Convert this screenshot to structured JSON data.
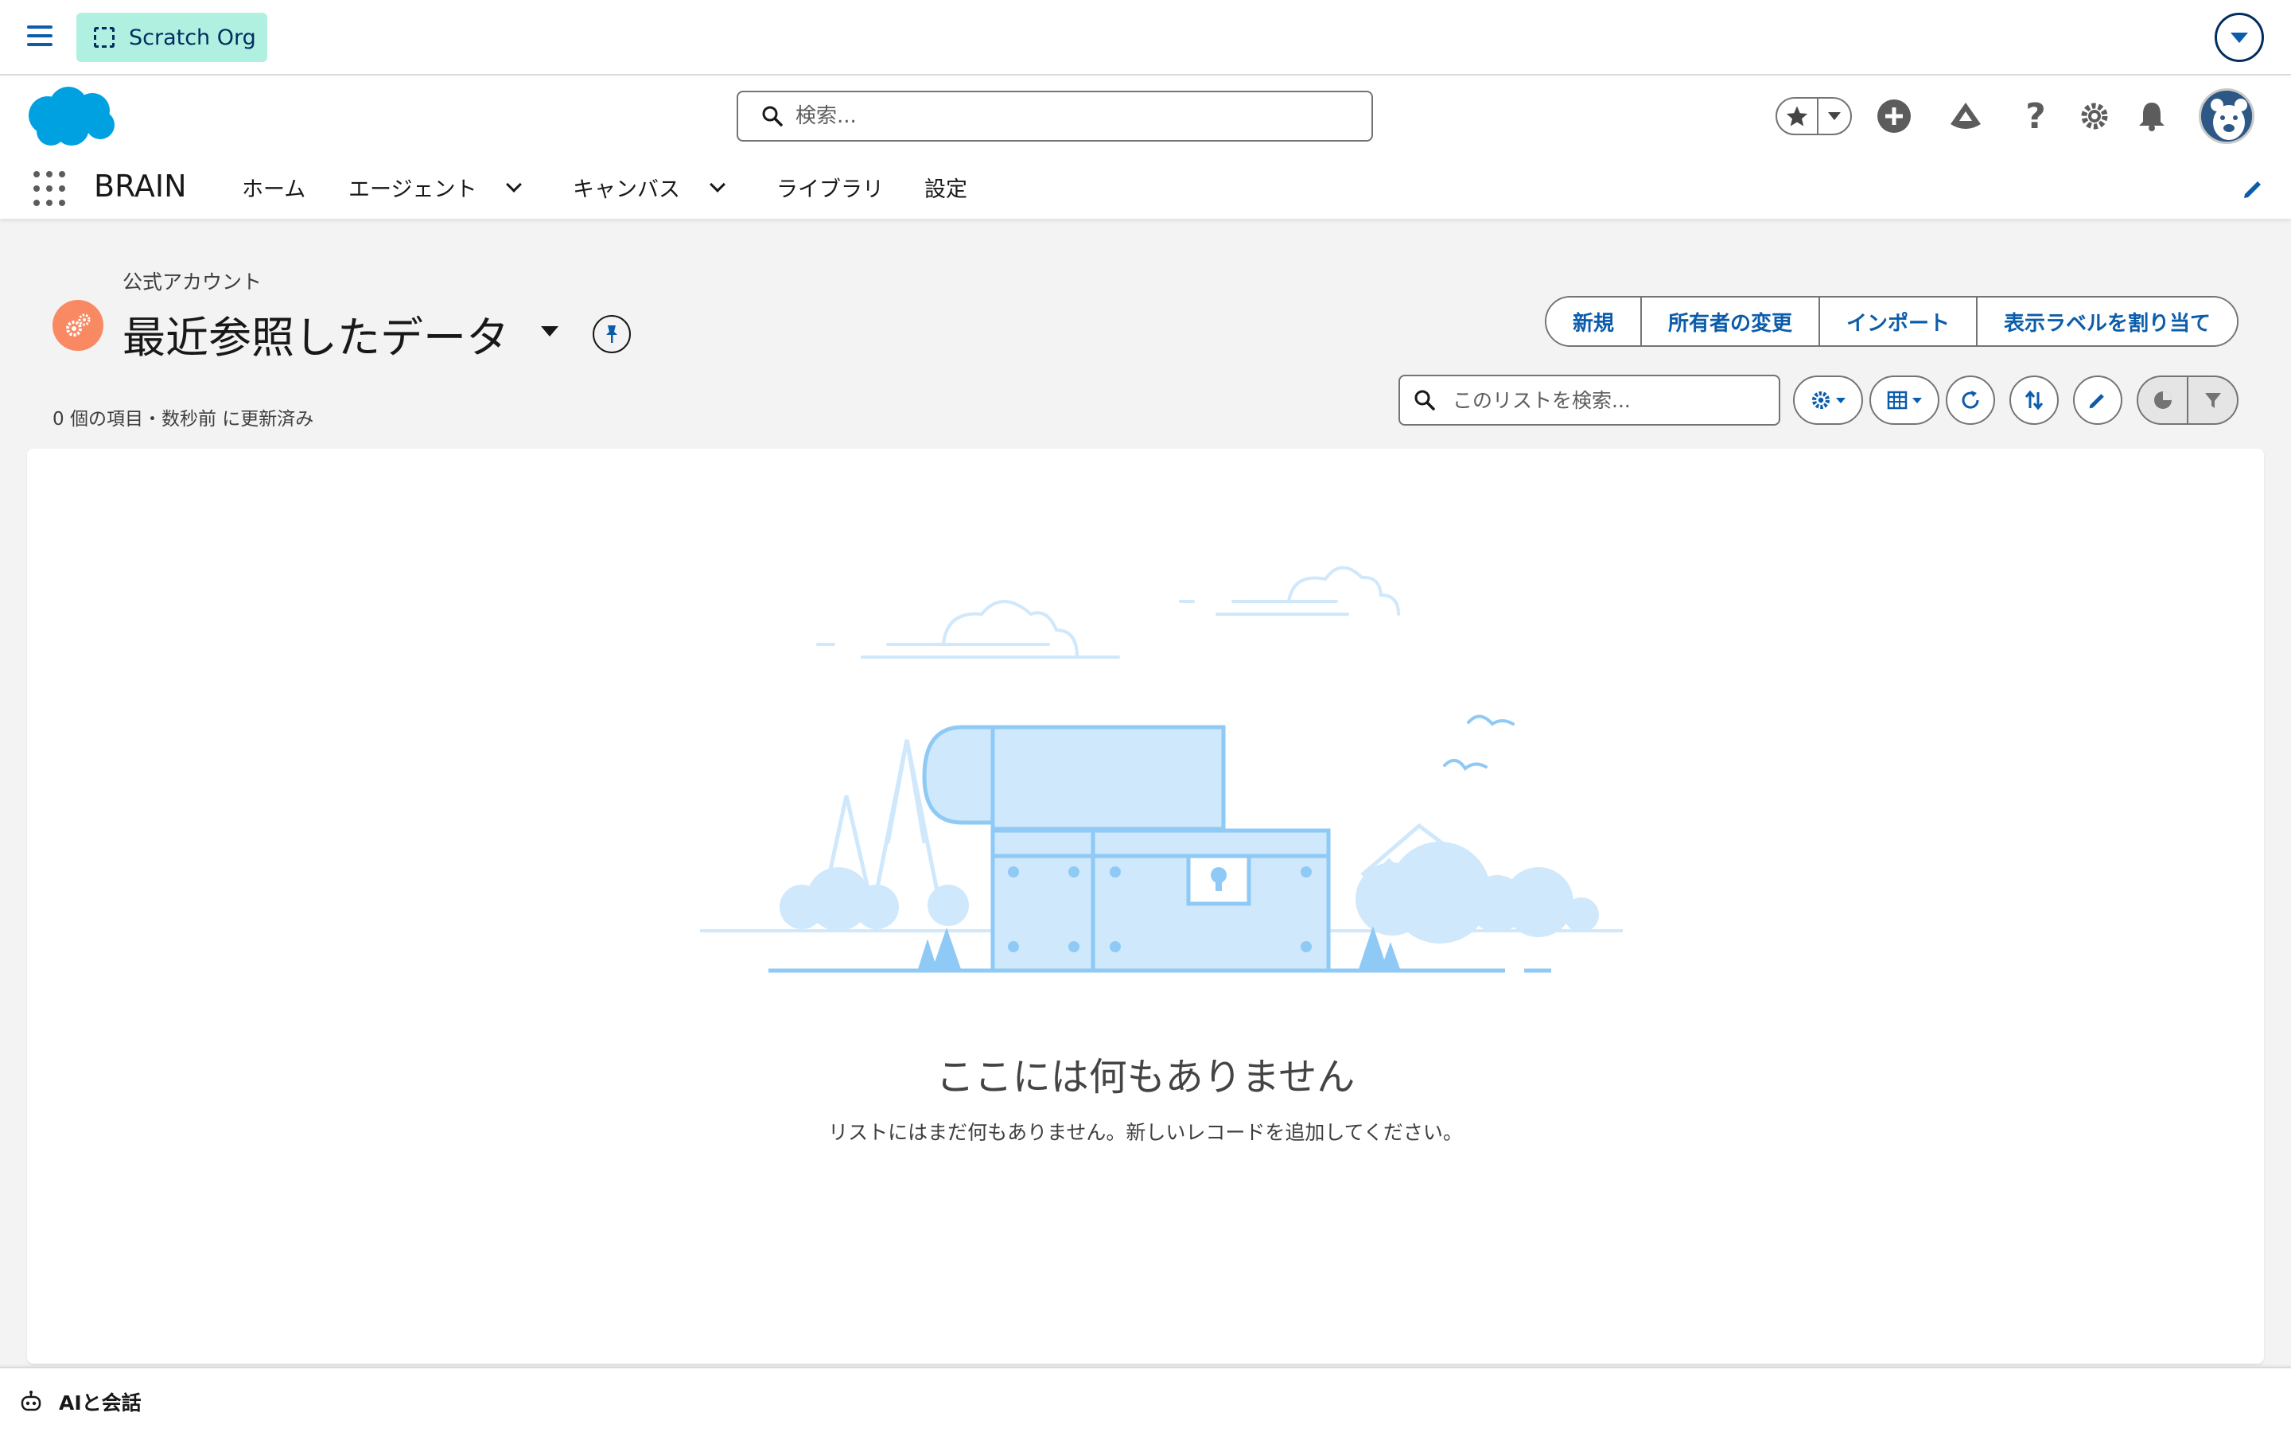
{
  "topbar": {
    "menu_icon": "hamburger-icon",
    "org_badge": "Scratch Org",
    "dropdown_icon": "chevron-down-icon"
  },
  "header": {
    "search_placeholder": "検索...",
    "icons": [
      "favorites-star-icon",
      "favorites-dropdown-icon",
      "global-actions-plus-icon",
      "trailhead-icon",
      "help-icon",
      "setup-gear-icon",
      "notifications-bell-icon",
      "user-avatar"
    ]
  },
  "nav": {
    "app_name": "BRAIN",
    "items": [
      {
        "label": "ホーム",
        "has_menu": false
      },
      {
        "label": "エージェント",
        "has_menu": true
      },
      {
        "label": "キャンバス",
        "has_menu": true
      },
      {
        "label": "ライブラリ",
        "has_menu": false
      },
      {
        "label": "設定",
        "has_menu": false
      }
    ]
  },
  "list_view": {
    "object_label": "公式アカウント",
    "title": "最近参照したデータ",
    "status": "0 個の項目・数秒前 に更新済み",
    "search_placeholder": "このリストを検索...",
    "buttons": [
      "新規",
      "所有者の変更",
      "インポート",
      "表示ラベルを割り当て"
    ]
  },
  "empty_state": {
    "title": "ここには何もありません",
    "subtitle": "リストにはまだ何もありません。新しいレコードを追加してください。"
  },
  "utility_bar": {
    "item_label": "AIと会話"
  },
  "colors": {
    "brand_blue": "#0b5cab",
    "scratch_badge": "#b0f0e0",
    "object_icon": "#f88962",
    "illustration_stroke": "#8ecaf5",
    "illustration_fill": "#cfe8fc"
  }
}
